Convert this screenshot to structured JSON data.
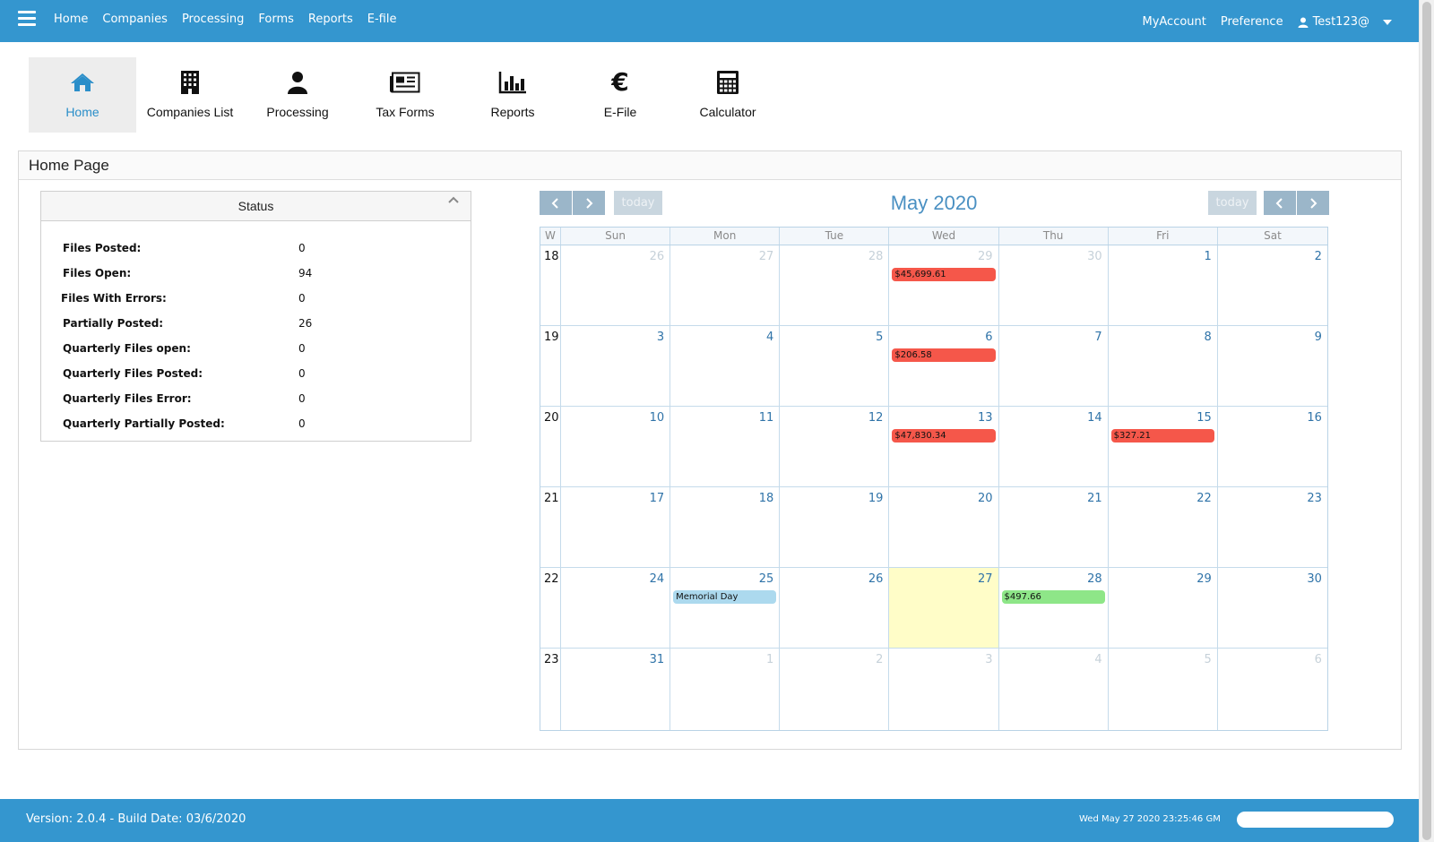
{
  "topnav": {
    "items": [
      "Home",
      "Companies",
      "Processing",
      "Forms",
      "Reports",
      "E-file"
    ],
    "right": {
      "my_account": "MyAccount",
      "preference": "Preference",
      "user": "Test123@"
    }
  },
  "toolbar": {
    "items": [
      {
        "label": "Home",
        "icon": "home-icon",
        "active": true
      },
      {
        "label": "Companies List",
        "icon": "building-icon"
      },
      {
        "label": "Processing",
        "icon": "user-icon"
      },
      {
        "label": "Tax Forms",
        "icon": "newspaper-icon"
      },
      {
        "label": "Reports",
        "icon": "bar-chart-icon"
      },
      {
        "label": "E-File",
        "icon": "euro-icon"
      },
      {
        "label": "Calculator",
        "icon": "calculator-icon"
      }
    ]
  },
  "panel": {
    "title": "Home Page"
  },
  "status": {
    "title": "Status",
    "rows": [
      {
        "label": "Files Posted:",
        "value": "0"
      },
      {
        "label": "Files Open:",
        "value": "94"
      },
      {
        "label": "Files With Errors:",
        "value": "0"
      },
      {
        "label": "Partially Posted:",
        "value": "26"
      },
      {
        "label": "Quarterly Files open:",
        "value": "0"
      },
      {
        "label": "Quarterly Files Posted:",
        "value": "0"
      },
      {
        "label": "Quarterly Files Error:",
        "value": "0"
      },
      {
        "label": "Quarterly Partially Posted:",
        "value": "0"
      }
    ]
  },
  "calendar": {
    "title": "May 2020",
    "today_label": "today",
    "prev_icon": "chevron-left-icon",
    "next_icon": "chevron-right-icon",
    "week_header": "W",
    "days_of_week": [
      "Sun",
      "Mon",
      "Tue",
      "Wed",
      "Thu",
      "Fri",
      "Sat"
    ],
    "weeks": [
      {
        "num": "18",
        "days": [
          {
            "d": "26",
            "other": true
          },
          {
            "d": "27",
            "other": true
          },
          {
            "d": "28",
            "other": true
          },
          {
            "d": "29",
            "other": true,
            "event": {
              "text": "$45,699.61",
              "color": "#f5574a"
            }
          },
          {
            "d": "30",
            "other": true
          },
          {
            "d": "1"
          },
          {
            "d": "2"
          }
        ]
      },
      {
        "num": "19",
        "days": [
          {
            "d": "3"
          },
          {
            "d": "4"
          },
          {
            "d": "5"
          },
          {
            "d": "6",
            "event": {
              "text": "$206.58",
              "color": "#f5574a"
            }
          },
          {
            "d": "7"
          },
          {
            "d": "8"
          },
          {
            "d": "9"
          }
        ]
      },
      {
        "num": "20",
        "days": [
          {
            "d": "10"
          },
          {
            "d": "11"
          },
          {
            "d": "12"
          },
          {
            "d": "13",
            "event": {
              "text": "$47,830.34",
              "color": "#f5574a"
            }
          },
          {
            "d": "14"
          },
          {
            "d": "15",
            "event": {
              "text": "$327.21",
              "color": "#f5574a"
            }
          },
          {
            "d": "16"
          }
        ]
      },
      {
        "num": "21",
        "days": [
          {
            "d": "17"
          },
          {
            "d": "18"
          },
          {
            "d": "19"
          },
          {
            "d": "20"
          },
          {
            "d": "21"
          },
          {
            "d": "22"
          },
          {
            "d": "23"
          }
        ]
      },
      {
        "num": "22",
        "days": [
          {
            "d": "24"
          },
          {
            "d": "25",
            "event": {
              "text": "Memorial Day",
              "color": "#acd9ee"
            }
          },
          {
            "d": "26"
          },
          {
            "d": "27",
            "today": true
          },
          {
            "d": "28",
            "event": {
              "text": "$497.66",
              "color": "#8ee688"
            }
          },
          {
            "d": "29"
          },
          {
            "d": "30"
          }
        ]
      },
      {
        "num": "23",
        "days": [
          {
            "d": "31"
          },
          {
            "d": "1",
            "other": true
          },
          {
            "d": "2",
            "other": true
          },
          {
            "d": "3",
            "other": true
          },
          {
            "d": "4",
            "other": true
          },
          {
            "d": "5",
            "other": true
          },
          {
            "d": "6",
            "other": true
          }
        ]
      }
    ]
  },
  "footer": {
    "version": "Version: 2.0.4 - Build Date: 03/6/2020",
    "datetime": "Wed May 27 2020 23:25:46 GM"
  },
  "colors": {
    "brand": "#3496cf",
    "accent": "#2a8ec9",
    "event_red": "#f5574a",
    "today_bg": "#fffdc8"
  }
}
